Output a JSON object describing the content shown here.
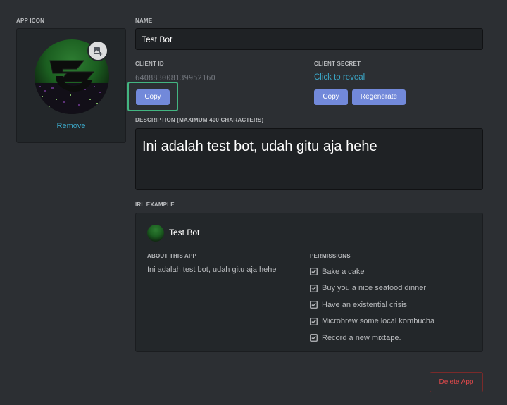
{
  "app_icon": {
    "label": "APP ICON",
    "remove_label": "Remove",
    "upload_icon": "image-add-icon"
  },
  "name": {
    "label": "NAME",
    "value": "Test Bot"
  },
  "client_id": {
    "label": "CLIENT ID",
    "value": "640883008139952160",
    "copy_label": "Copy"
  },
  "client_secret": {
    "label": "CLIENT SECRET",
    "reveal_label": "Click to reveal",
    "copy_label": "Copy",
    "regenerate_label": "Regenerate"
  },
  "description": {
    "label": "DESCRIPTION (MAXIMUM 400 CHARACTERS)",
    "value": "Ini adalah test bot, udah gitu aja hehe"
  },
  "preview": {
    "label": "IRL EXAMPLE",
    "bot_name": "Test Bot",
    "about_label": "ABOUT THIS APP",
    "about_text": "Ini adalah test bot, udah gitu aja hehe",
    "permissions_label": "PERMISSIONS",
    "permissions": [
      "Bake a cake",
      "Buy you a nice seafood dinner",
      "Have an existential crisis",
      "Microbrew some local kombucha",
      "Record a new mixtape."
    ]
  },
  "delete_label": "Delete App",
  "colors": {
    "background": "#2c2f33",
    "accent": "#7289da",
    "link": "#3ba6c6",
    "focus": "#43b581",
    "danger": "#e0494b"
  }
}
